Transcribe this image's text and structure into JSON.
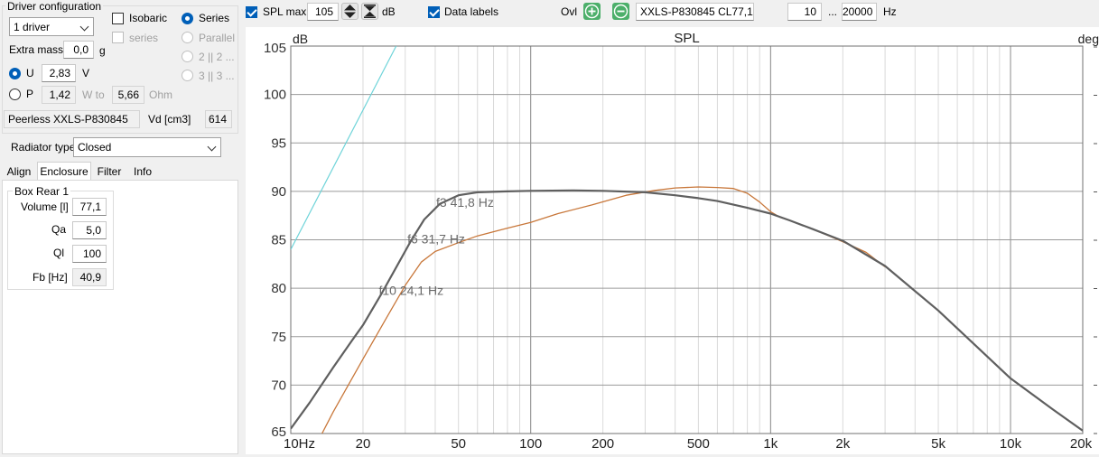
{
  "driver_config": {
    "title": "Driver configuration",
    "driver_count": "1 driver",
    "isobaric_label": "Isobaric",
    "series_opt_label": "series",
    "extra_mass_label": "Extra mass",
    "extra_mass_value": "0,0",
    "extra_mass_unit": "g",
    "u_label": "U",
    "u_value": "2,83",
    "u_unit": "V",
    "p_label": "P",
    "p_value": "1,42",
    "w_to_label": "W to",
    "ohm_value": "5,66",
    "ohm_unit": "Ohm",
    "series_label": "Series",
    "parallel_label": "Parallel",
    "opt_2": "2 || 2 ...",
    "opt_3": "3 || 3 ...",
    "driver_name": "Peerless XXLS-P830845",
    "vd_label": "Vd [cm3]",
    "vd_value": "614"
  },
  "radiator": {
    "label": "Radiator type",
    "value": "Closed"
  },
  "tabs": [
    "Align",
    "Enclosure",
    "Filter",
    "Info"
  ],
  "enclosure": {
    "group_title": "Box Rear 1",
    "volume_label": "Volume [l]",
    "volume_value": "77,1",
    "qa_label": "Qa",
    "qa_value": "5,0",
    "ql_label": "Ql",
    "ql_value": "100",
    "fb_label": "Fb [Hz]",
    "fb_value": "40,9"
  },
  "toolbar": {
    "spl_max_label": "SPL max",
    "spl_max_value": "105",
    "spl_unit": "dB",
    "data_labels_label": "Data labels",
    "ovl_label": "Ovl",
    "overlay_name": "XXLS-P830845 CL77,1",
    "f_min": "10",
    "range_sep": "...",
    "f_max": "20000",
    "hz_unit": "Hz"
  },
  "colors": {
    "accent": "#005fb8",
    "ovl_button": "#4caf6a",
    "main_curve": "#5f5f5f",
    "overlay_curve": "#c8773a",
    "cyan_line": "#6fd4d9"
  },
  "chart_data": {
    "type": "line",
    "title": "SPL",
    "ylabel": "dB",
    "y2label": "deg",
    "xscale": "log",
    "xlim": [
      10,
      20000
    ],
    "ylim": [
      65,
      105
    ],
    "x_ticks": [
      10,
      20,
      50,
      100,
      200,
      500,
      1000,
      2000,
      5000,
      10000,
      20000
    ],
    "x_tick_labels": [
      "10Hz",
      "20",
      "50",
      "100",
      "200",
      "500",
      "1k",
      "2k",
      "5k",
      "10k",
      "20k"
    ],
    "y_ticks": [
      65,
      70,
      75,
      80,
      85,
      90,
      95,
      100,
      105
    ],
    "grid": true,
    "series": [
      {
        "role": "main",
        "points": [
          [
            10,
            65.5
          ],
          [
            12,
            68.2
          ],
          [
            15,
            71.8
          ],
          [
            18,
            74.6
          ],
          [
            20,
            76.2
          ],
          [
            24.1,
            79.6
          ],
          [
            28,
            82.5
          ],
          [
            31.7,
            84.9
          ],
          [
            36,
            87.1
          ],
          [
            41.8,
            88.7
          ],
          [
            50,
            89.6
          ],
          [
            60,
            89.9
          ],
          [
            80,
            90.0
          ],
          [
            100,
            90.05
          ],
          [
            150,
            90.1
          ],
          [
            200,
            90.05
          ],
          [
            300,
            89.9
          ],
          [
            400,
            89.6
          ],
          [
            500,
            89.3
          ],
          [
            600,
            89.0
          ],
          [
            800,
            88.3
          ],
          [
            1000,
            87.7
          ],
          [
            1200,
            87.0
          ],
          [
            1500,
            86.1
          ],
          [
            2000,
            84.9
          ],
          [
            3000,
            82.3
          ],
          [
            5000,
            77.7
          ],
          [
            7000,
            74.3
          ],
          [
            10000,
            70.7
          ],
          [
            15000,
            67.5
          ],
          [
            20000,
            65.3
          ]
        ]
      },
      {
        "role": "overlay",
        "points": [
          [
            13.5,
            65
          ],
          [
            15,
            67.2
          ],
          [
            20,
            72.7
          ],
          [
            25,
            76.9
          ],
          [
            30,
            80.3
          ],
          [
            35,
            82.7
          ],
          [
            40,
            83.8
          ],
          [
            50,
            84.7
          ],
          [
            60,
            85.4
          ],
          [
            80,
            86.2
          ],
          [
            100,
            86.8
          ],
          [
            130,
            87.7
          ],
          [
            180,
            88.6
          ],
          [
            250,
            89.6
          ],
          [
            330,
            90.1
          ],
          [
            400,
            90.35
          ],
          [
            500,
            90.45
          ],
          [
            600,
            90.4
          ],
          [
            700,
            90.3
          ],
          [
            800,
            89.8
          ],
          [
            900,
            88.9
          ],
          [
            1000,
            87.9
          ],
          [
            1100,
            87.3
          ],
          [
            1200,
            87.0
          ],
          [
            1500,
            86.1
          ],
          [
            2000,
            84.8
          ],
          [
            2500,
            83.7
          ],
          [
            3000,
            82.2
          ]
        ]
      },
      {
        "role": "reference",
        "points": [
          [
            10,
            84
          ],
          [
            27.5,
            105
          ]
        ]
      }
    ],
    "annotations": [
      {
        "text": "f3 41,8 Hz",
        "x": 41.8,
        "y": 88.7
      },
      {
        "text": "f6 31,7 Hz",
        "x": 31.7,
        "y": 84.9
      },
      {
        "text": "f10 24,1 Hz",
        "x": 24.1,
        "y": 79.6
      }
    ]
  }
}
